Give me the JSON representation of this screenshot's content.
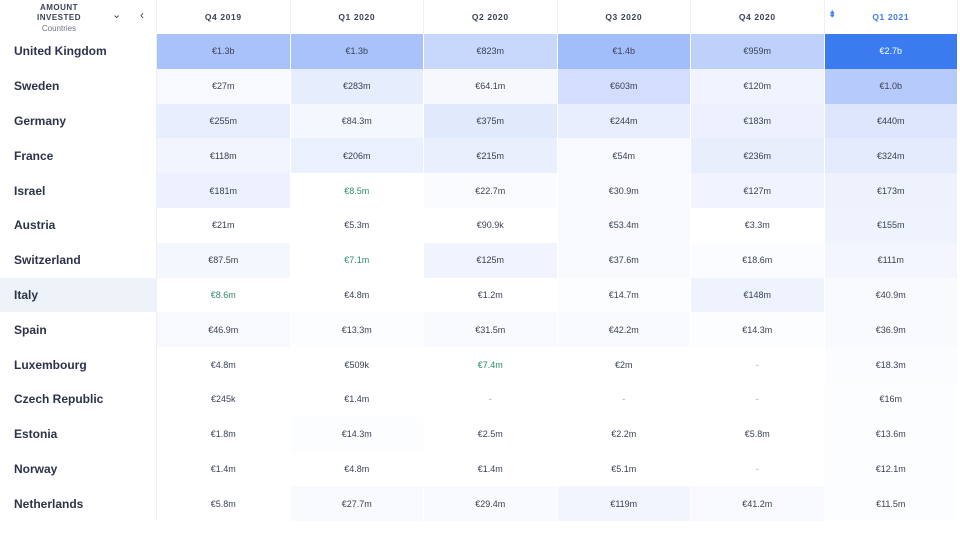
{
  "corner": {
    "line1": "AMOUNT",
    "line2": "INVESTED",
    "line3": "Countries",
    "chevron": "⌄",
    "back": "‹"
  },
  "columns": [
    "Q4 2019",
    "Q1 2020",
    "Q2 2020",
    "Q3 2020",
    "Q4 2020",
    "Q1 2021"
  ],
  "sorted_column_index": 5,
  "sort_icon": "sort-descending-icon",
  "highlighted_row": "Italy",
  "rows": [
    {
      "name": "United Kingdom",
      "cells": [
        {
          "v": "€1.3b",
          "bg": "#a9c3fa"
        },
        {
          "v": "€1.3b",
          "bg": "#a9c3fa"
        },
        {
          "v": "€823m",
          "bg": "#c8d8fc"
        },
        {
          "v": "€1.4b",
          "bg": "#a2befa"
        },
        {
          "v": "€959m",
          "bg": "#bed1fb"
        },
        {
          "v": "€2.7b",
          "bg": "#3b7bf0",
          "fg": "#ffffff"
        }
      ]
    },
    {
      "name": "Sweden",
      "cells": [
        {
          "v": "€27m",
          "bg": "#f8f9fe"
        },
        {
          "v": "€283m",
          "bg": "#e6edfd"
        },
        {
          "v": "€64.1m",
          "bg": "#f6f8fe"
        },
        {
          "v": "€603m",
          "bg": "#d2defc"
        },
        {
          "v": "€120m",
          "bg": "#f1f4fe"
        },
        {
          "v": "€1.0b",
          "bg": "#b6cbfb"
        }
      ]
    },
    {
      "name": "Germany",
      "cells": [
        {
          "v": "€255m",
          "bg": "#e8eefd"
        },
        {
          "v": "€84.3m",
          "bg": "#f5f7fe"
        },
        {
          "v": "€375m",
          "bg": "#e1e9fd"
        },
        {
          "v": "€244m",
          "bg": "#e8eefd"
        },
        {
          "v": "€183m",
          "bg": "#ecf1fd"
        },
        {
          "v": "€440m",
          "bg": "#dde6fd"
        }
      ]
    },
    {
      "name": "France",
      "cells": [
        {
          "v": "€118m",
          "bg": "#f2f5fe"
        },
        {
          "v": "€206m",
          "bg": "#ebf0fd"
        },
        {
          "v": "€215m",
          "bg": "#eaeffd"
        },
        {
          "v": "€54m",
          "bg": "#f7f9fe"
        },
        {
          "v": "€236m",
          "bg": "#e9eefd"
        },
        {
          "v": "€324m",
          "bg": "#e4ebfd"
        }
      ]
    },
    {
      "name": "Israel",
      "cells": [
        {
          "v": "€181m",
          "bg": "#edf1fd"
        },
        {
          "v": "€8.5m",
          "fg": "#2e8a6f",
          "bg": "#ffffff"
        },
        {
          "v": "€22.7m",
          "bg": "#fafbff"
        },
        {
          "v": "€30.9m",
          "bg": "#f9fafe"
        },
        {
          "v": "€127m",
          "bg": "#f1f4fe"
        },
        {
          "v": "€173m",
          "bg": "#eef2fd"
        }
      ]
    },
    {
      "name": "Austria",
      "cells": [
        {
          "v": "€21m",
          "bg": "#ffffff"
        },
        {
          "v": "€5.3m",
          "bg": "#ffffff"
        },
        {
          "v": "€90.9k",
          "bg": "#ffffff"
        },
        {
          "v": "€53.4m",
          "bg": "#f8f9fe"
        },
        {
          "v": "€3.3m",
          "bg": "#ffffff"
        },
        {
          "v": "€155m",
          "bg": "#eff3fe"
        }
      ]
    },
    {
      "name": "Switzerland",
      "cells": [
        {
          "v": "€87.5m",
          "bg": "#f5f7fe"
        },
        {
          "v": "€7.1m",
          "fg": "#2e8a6f",
          "bg": "#ffffff"
        },
        {
          "v": "€125m",
          "bg": "#f1f4fe"
        },
        {
          "v": "€37.6m",
          "bg": "#f9fafe"
        },
        {
          "v": "€18.6m",
          "bg": "#fbfcff"
        },
        {
          "v": "€111m",
          "bg": "#f3f6fe"
        }
      ]
    },
    {
      "name": "Italy",
      "cells": [
        {
          "v": "€8.6m",
          "fg": "#2e8a6f",
          "bg": "#ffffff"
        },
        {
          "v": "€4.8m",
          "bg": "#ffffff"
        },
        {
          "v": "€1.2m",
          "bg": "#ffffff"
        },
        {
          "v": "€14.7m",
          "bg": "#fcfdff"
        },
        {
          "v": "€148m",
          "bg": "#eff3fe"
        },
        {
          "v": "€40.9m",
          "bg": "#f9fafe"
        }
      ]
    },
    {
      "name": "Spain",
      "cells": [
        {
          "v": "€46.9m",
          "bg": "#f8f9fe"
        },
        {
          "v": "€13.3m",
          "bg": "#fcfdff"
        },
        {
          "v": "€31.5m",
          "bg": "#f9fafe"
        },
        {
          "v": "€42.2m",
          "bg": "#f9fafe"
        },
        {
          "v": "€14.3m",
          "bg": "#fcfdff"
        },
        {
          "v": "€36.9m",
          "bg": "#f9fafe"
        }
      ]
    },
    {
      "name": "Luxembourg",
      "cells": [
        {
          "v": "€4.8m",
          "bg": "#ffffff"
        },
        {
          "v": "€509k",
          "bg": "#ffffff"
        },
        {
          "v": "€7.4m",
          "fg": "#2e8a6f",
          "bg": "#ffffff"
        },
        {
          "v": "€2m",
          "bg": "#ffffff"
        },
        {
          "v": "-",
          "dash": true,
          "bg": "#ffffff"
        },
        {
          "v": "€18.3m",
          "bg": "#fbfcff"
        }
      ]
    },
    {
      "name": "Czech Republic",
      "cells": [
        {
          "v": "€245k",
          "bg": "#ffffff"
        },
        {
          "v": "€1.4m",
          "bg": "#ffffff"
        },
        {
          "v": "-",
          "dash": true,
          "bg": "#ffffff"
        },
        {
          "v": "-",
          "dash": true,
          "bg": "#ffffff"
        },
        {
          "v": "-",
          "dash": true,
          "bg": "#ffffff"
        },
        {
          "v": "€16m",
          "bg": "#fcfdff"
        }
      ]
    },
    {
      "name": "Estonia",
      "cells": [
        {
          "v": "€1.8m",
          "bg": "#ffffff"
        },
        {
          "v": "€14.3m",
          "bg": "#fcfdff"
        },
        {
          "v": "€2.5m",
          "bg": "#ffffff"
        },
        {
          "v": "€2.2m",
          "bg": "#ffffff"
        },
        {
          "v": "€5.8m",
          "bg": "#ffffff"
        },
        {
          "v": "€13.6m",
          "bg": "#fcfdff"
        }
      ]
    },
    {
      "name": "Norway",
      "cells": [
        {
          "v": "€1.4m",
          "bg": "#ffffff"
        },
        {
          "v": "€4.8m",
          "bg": "#ffffff"
        },
        {
          "v": "€1.4m",
          "bg": "#ffffff"
        },
        {
          "v": "€5.1m",
          "bg": "#ffffff"
        },
        {
          "v": "-",
          "dash": true,
          "bg": "#ffffff"
        },
        {
          "v": "€12.1m",
          "bg": "#fcfdff"
        }
      ]
    },
    {
      "name": "Netherlands",
      "cells": [
        {
          "v": "€5.8m",
          "bg": "#ffffff"
        },
        {
          "v": "€27.7m",
          "bg": "#f9fafe"
        },
        {
          "v": "€29.4m",
          "bg": "#f9fafe"
        },
        {
          "v": "€119m",
          "bg": "#f2f5fe"
        },
        {
          "v": "€41.2m",
          "bg": "#f8f9fe"
        },
        {
          "v": "€11.5m",
          "bg": "#fcfdff"
        }
      ]
    }
  ]
}
